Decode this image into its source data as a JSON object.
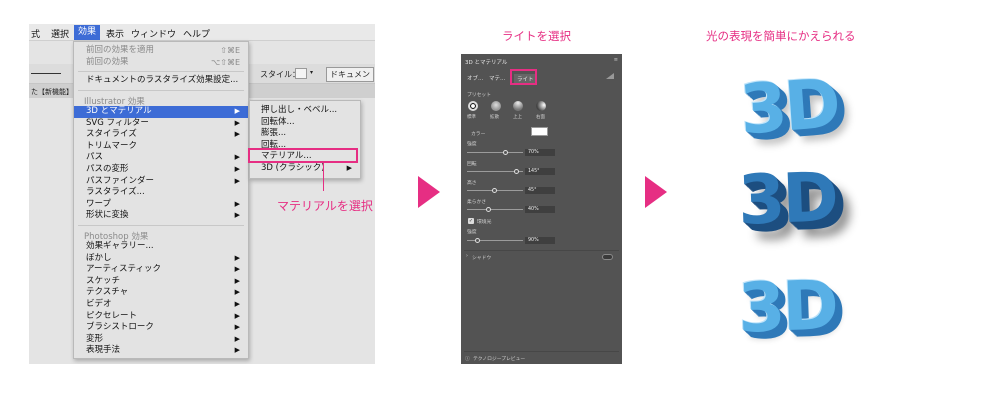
{
  "menubar": {
    "items": [
      "式",
      "選択",
      "効果",
      "表示",
      "ウィンドウ",
      "ヘルプ"
    ],
    "active_index": 2
  },
  "control_bar": {
    "style_label": "スタイル：",
    "document_button": "ドキュメン",
    "tab_label": "た【新機能】"
  },
  "effect_menu": {
    "repeat_last": {
      "label": "前回の効果を適用",
      "shortcut": "⇧⌘E"
    },
    "last_effect": {
      "label": "前回の効果",
      "shortcut": "⌥⇧⌘E"
    },
    "rasterize_settings": "ドキュメントのラスタライズ効果設定...",
    "illustrator_header": "Illustrator 効果",
    "illustrator_items": [
      {
        "label": "3D とマテリアル",
        "submenu": true,
        "highlighted": true
      },
      {
        "label": "SVG フィルター",
        "submenu": true
      },
      {
        "label": "スタイライズ",
        "submenu": true
      },
      {
        "label": "トリムマーク",
        "submenu": false
      },
      {
        "label": "パス",
        "submenu": true
      },
      {
        "label": "パスの変形",
        "submenu": true
      },
      {
        "label": "パスファインダー",
        "submenu": true
      },
      {
        "label": "ラスタライズ...",
        "submenu": false
      },
      {
        "label": "ワープ",
        "submenu": true
      },
      {
        "label": "形状に変換",
        "submenu": true
      }
    ],
    "photoshop_header": "Photoshop 効果",
    "photoshop_items": [
      {
        "label": "効果ギャラリー...",
        "submenu": false
      },
      {
        "label": "ぼかし",
        "submenu": true
      },
      {
        "label": "アーティスティック",
        "submenu": true
      },
      {
        "label": "スケッチ",
        "submenu": true
      },
      {
        "label": "テクスチャ",
        "submenu": true
      },
      {
        "label": "ビデオ",
        "submenu": true
      },
      {
        "label": "ピクセレート",
        "submenu": true
      },
      {
        "label": "ブラシストローク",
        "submenu": true
      },
      {
        "label": "変形",
        "submenu": true
      },
      {
        "label": "表現手法",
        "submenu": true
      }
    ]
  },
  "submenu_3d": {
    "items": [
      {
        "label": "押し出し・ベベル...",
        "submenu": false
      },
      {
        "label": "回転体...",
        "submenu": false
      },
      {
        "label": "膨張...",
        "submenu": false
      },
      {
        "label": "回転...",
        "submenu": false
      },
      {
        "label": "マテリアル...",
        "submenu": false,
        "highlighted": true
      },
      {
        "label": "3D (クラシック)",
        "submenu": true
      }
    ]
  },
  "annotations": {
    "select_material": "マテリアルを選択",
    "select_light": "ライトを選択",
    "easy_light": "光の表現を簡単にかえられる"
  },
  "panel_3d": {
    "title": "3D とマテリアル",
    "tabs": [
      "オブ...",
      "マテ...",
      "ライト"
    ],
    "active_tab": 2,
    "presets_label": "プリセット",
    "presets": [
      "標準",
      "拡散",
      "上上",
      "右面"
    ],
    "color_label": "カラー",
    "color_value": "#ffffff",
    "intensity": {
      "label": "強度",
      "value": "70%",
      "fraction": 0.7
    },
    "rotation": {
      "label": "回転",
      "value": "145°",
      "fraction": 0.9
    },
    "height": {
      "label": "高さ",
      "value": "45°",
      "fraction": 0.5
    },
    "softness": {
      "label": "柔らかさ",
      "value": "40%",
      "fraction": 0.4
    },
    "ambient": {
      "label": "環境光",
      "checked": true
    },
    "ambient_intensity": {
      "label": "強度",
      "value": "90%",
      "fraction": 0.2
    },
    "shadows_label": "シャドウ",
    "raytrace_label": "ラ ... ーイングプレビュー",
    "footer_label": "テクノロジープレビュー"
  },
  "samples": {
    "text": "3D",
    "colors": {
      "face": "#58b0e6",
      "side": "#2f79b8",
      "dark": "#1d4e80",
      "highlight": "#bfe4fa"
    }
  },
  "colors": {
    "accent": "#e62e83",
    "menu_highlight": "#3d6cd6",
    "panel_bg": "#535353"
  }
}
